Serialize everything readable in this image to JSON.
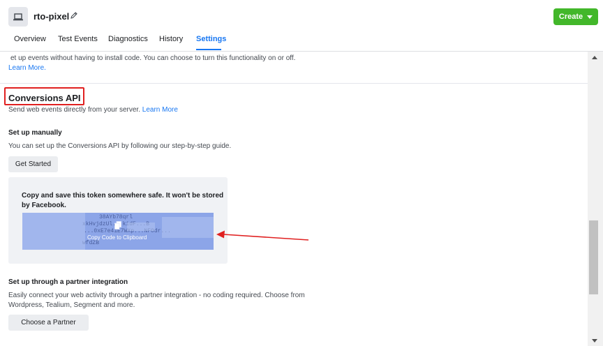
{
  "header": {
    "pixel_name": "rto-pixel",
    "create_label": "Create",
    "tabs": [
      "Overview",
      "Test Events",
      "Diagnostics",
      "History",
      "Settings"
    ]
  },
  "content": {
    "intro_text": "et up events without having to install code. You can choose to turn this functionality on or off.",
    "intro_link": "Learn More.",
    "section_title": "Conversions API",
    "section_desc": "Send web events directly from your server.",
    "section_link": "Learn More",
    "manual": {
      "title": "Set up manually",
      "desc": "You can set up the Conversions API by following our step-by-step guide.",
      "button": "Get Started"
    },
    "token": {
      "message": "Copy and save this token somewhere safe. It won't be stored by Facebook.",
      "code_lines": [
        "38AYb78qrl",
        "xkHvjdzUl...kidF...B",
        "...0xE7e41E7WXp...NFOdr...",
        "wfdZB"
      ],
      "copy_label": "Copy Code to Clipboard"
    },
    "partner": {
      "title": "Set up through a partner integration",
      "desc_line1": "Easily connect your web activity through a partner integration - no coding required. Choose from",
      "desc_line2": "Wordpress, Tealium, Segment and more.",
      "button": "Choose a Partner"
    }
  },
  "colors": {
    "accent": "#1877f2",
    "create": "#42b72a",
    "highlight": "#e02020"
  }
}
